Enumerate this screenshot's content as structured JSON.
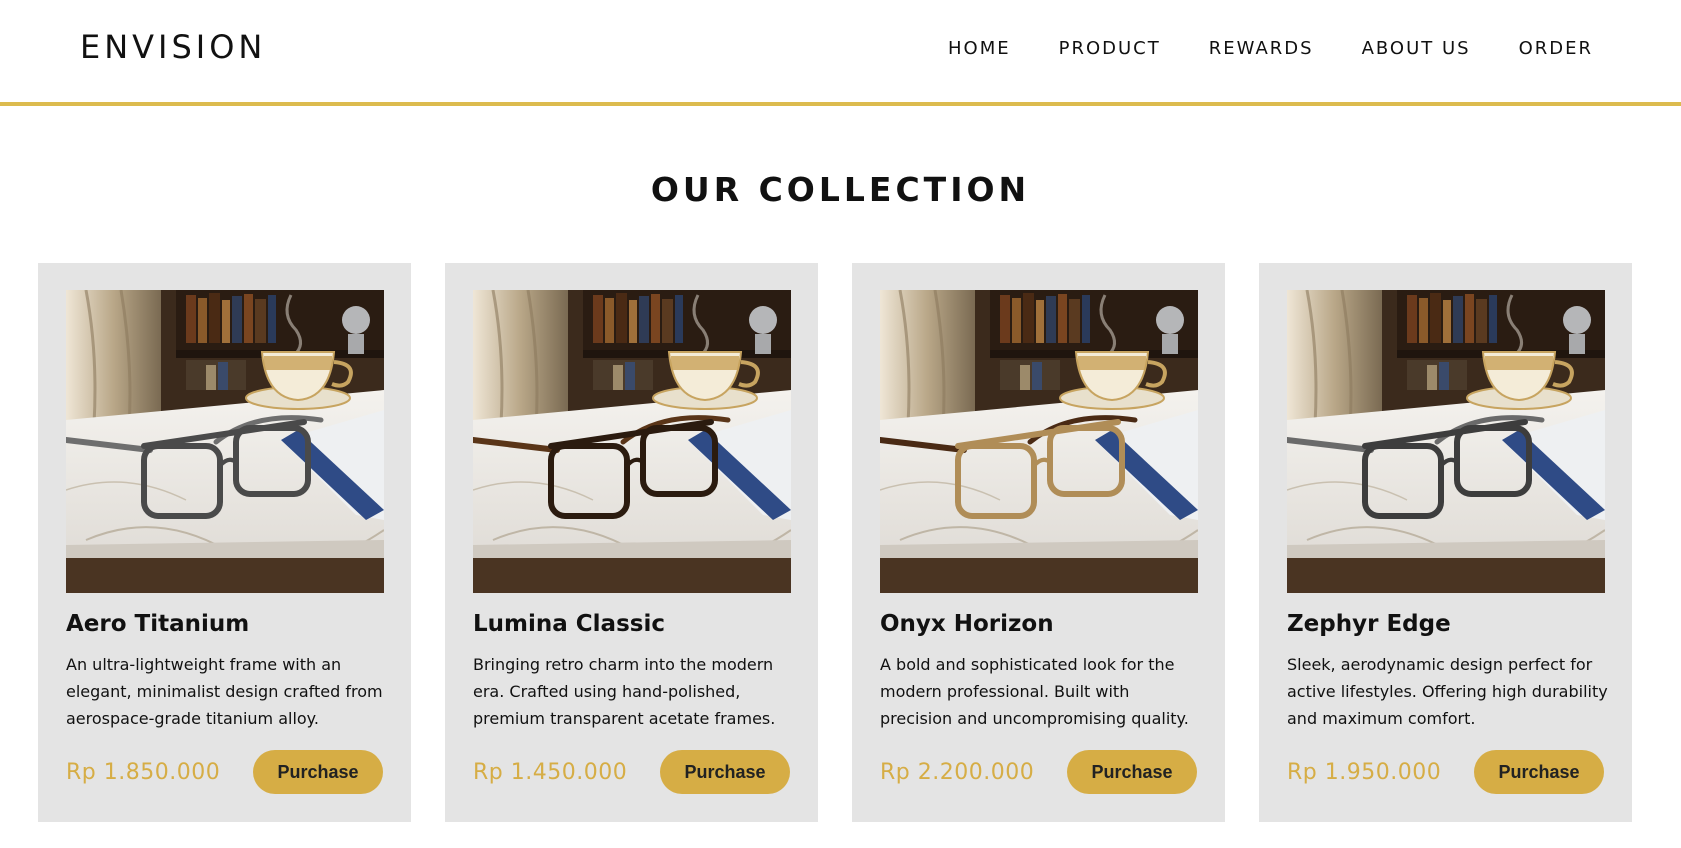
{
  "brand": {
    "name": "ENVISION"
  },
  "nav": [
    "HOME",
    "PRODUCT",
    "REWARDS",
    "ABOUT US",
    "ORDER"
  ],
  "section_title": "OUR COLLECTION",
  "products": [
    {
      "name": "Aero Titanium",
      "description": "An ultra-lightweight frame with an elegant, minimalist design crafted from aerospace-grade titanium alloy.",
      "price": "Rp 1.850.000",
      "button": "Purchase",
      "frame_color": "#4a4a4a",
      "temple_color": "#6e6e6e"
    },
    {
      "name": "Lumina Classic",
      "description": "Bringing retro charm into the modern era. Crafted using hand-polished, premium transparent acetate frames.",
      "price": "Rp 1.450.000",
      "button": "Purchase",
      "frame_color": "#2b1b0f",
      "temple_color": "#5a3518"
    },
    {
      "name": "Onyx Horizon",
      "description": "A bold and sophisticated look for the modern professional. Built with precision and uncompromising quality.",
      "price": "Rp 2.200.000",
      "button": "Purchase",
      "frame_color": "#b08d57",
      "temple_color": "#4a2a14"
    },
    {
      "name": "Zephyr Edge",
      "description": "Sleek, aerodynamic design perfect for active lifestyles. Offering high durability and maximum comfort.",
      "price": "Rp 1.950.000",
      "button": "Purchase",
      "frame_color": "#3d3d3d",
      "temple_color": "#6a6a6a"
    }
  ]
}
